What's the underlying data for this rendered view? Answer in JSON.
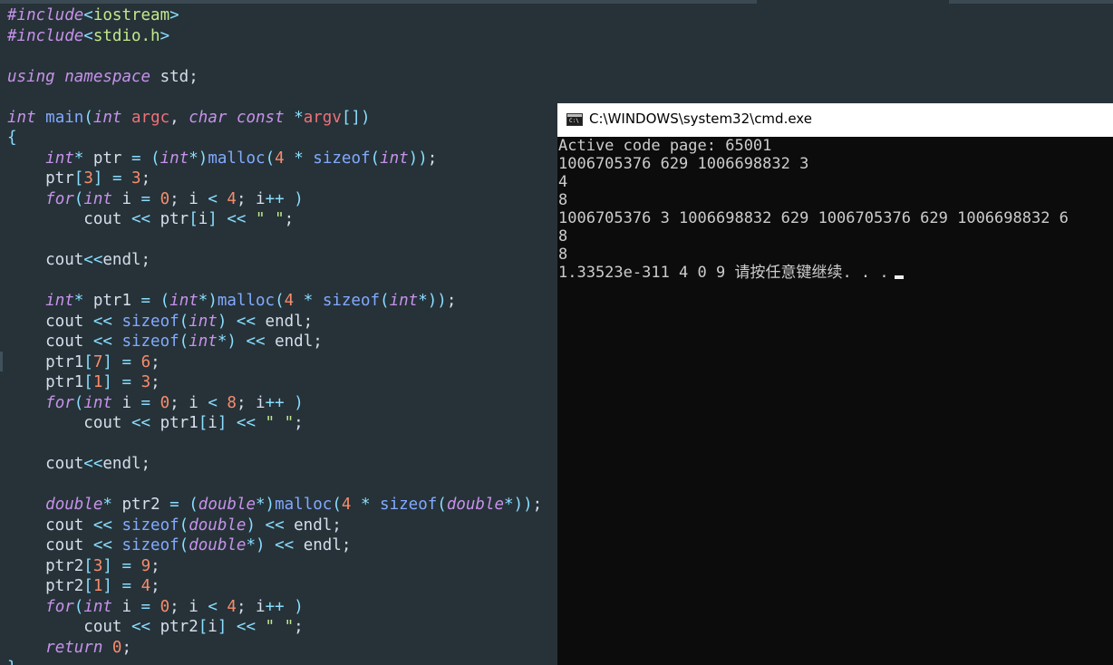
{
  "editor": {
    "lines": [
      {
        "t": [
          [
            "pp",
            "#include"
          ],
          [
            "op",
            "<"
          ],
          [
            "str",
            "iostream"
          ],
          [
            "op",
            ">"
          ]
        ]
      },
      {
        "t": [
          [
            "pp",
            "#include"
          ],
          [
            "op",
            "<"
          ],
          [
            "str",
            "stdio.h"
          ],
          [
            "op",
            ">"
          ]
        ]
      },
      {
        "t": []
      },
      {
        "t": [
          [
            "kw",
            "using"
          ],
          [
            "plain",
            " "
          ],
          [
            "kw",
            "namespace"
          ],
          [
            "plain",
            " std;"
          ]
        ]
      },
      {
        "t": []
      },
      {
        "t": [
          [
            "ty",
            "int"
          ],
          [
            "plain",
            " "
          ],
          [
            "fn",
            "main"
          ],
          [
            "br",
            "("
          ],
          [
            "ty",
            "int"
          ],
          [
            "plain",
            " "
          ],
          [
            "par",
            "argc"
          ],
          [
            "plain",
            ", "
          ],
          [
            "ty",
            "char"
          ],
          [
            "plain",
            " "
          ],
          [
            "kw",
            "const"
          ],
          [
            "plain",
            " "
          ],
          [
            "op",
            "*"
          ],
          [
            "par",
            "argv"
          ],
          [
            "br",
            "[])"
          ]
        ]
      },
      {
        "t": [
          [
            "br",
            "{"
          ]
        ]
      },
      {
        "t": [
          [
            "plain",
            "    "
          ],
          [
            "ty",
            "int"
          ],
          [
            "op",
            "*"
          ],
          [
            "plain",
            " ptr "
          ],
          [
            "op",
            "="
          ],
          [
            "plain",
            " "
          ],
          [
            "br",
            "("
          ],
          [
            "ty",
            "int"
          ],
          [
            "op",
            "*"
          ],
          [
            "br",
            ")"
          ],
          [
            "fn",
            "malloc"
          ],
          [
            "br",
            "("
          ],
          [
            "num",
            "4"
          ],
          [
            "plain",
            " "
          ],
          [
            "op",
            "*"
          ],
          [
            "plain",
            " "
          ],
          [
            "fn",
            "sizeof"
          ],
          [
            "br",
            "("
          ],
          [
            "ty",
            "int"
          ],
          [
            "br",
            "))"
          ],
          [
            "plain",
            ";"
          ]
        ]
      },
      {
        "t": [
          [
            "plain",
            "    ptr"
          ],
          [
            "br",
            "["
          ],
          [
            "num",
            "3"
          ],
          [
            "br",
            "]"
          ],
          [
            "plain",
            " "
          ],
          [
            "op",
            "="
          ],
          [
            "plain",
            " "
          ],
          [
            "num",
            "3"
          ],
          [
            "plain",
            ";"
          ]
        ]
      },
      {
        "t": [
          [
            "plain",
            "    "
          ],
          [
            "kw",
            "for"
          ],
          [
            "br",
            "("
          ],
          [
            "ty",
            "int"
          ],
          [
            "plain",
            " i "
          ],
          [
            "op",
            "="
          ],
          [
            "plain",
            " "
          ],
          [
            "num",
            "0"
          ],
          [
            "plain",
            "; i "
          ],
          [
            "op",
            "<"
          ],
          [
            "plain",
            " "
          ],
          [
            "num",
            "4"
          ],
          [
            "plain",
            "; i"
          ],
          [
            "op",
            "++"
          ],
          [
            "plain",
            " "
          ],
          [
            "br",
            ")"
          ]
        ]
      },
      {
        "t": [
          [
            "plain",
            "        cout "
          ],
          [
            "op",
            "<<"
          ],
          [
            "plain",
            " ptr"
          ],
          [
            "br",
            "["
          ],
          [
            "plain",
            "i"
          ],
          [
            "br",
            "]"
          ],
          [
            "plain",
            " "
          ],
          [
            "op",
            "<<"
          ],
          [
            "plain",
            " "
          ],
          [
            "str",
            "\" \""
          ],
          [
            "plain",
            ";"
          ]
        ]
      },
      {
        "t": []
      },
      {
        "t": [
          [
            "plain",
            "    cout"
          ],
          [
            "op",
            "<<"
          ],
          [
            "plain",
            "endl;"
          ]
        ]
      },
      {
        "t": []
      },
      {
        "t": [
          [
            "plain",
            "    "
          ],
          [
            "ty",
            "int"
          ],
          [
            "op",
            "*"
          ],
          [
            "plain",
            " ptr1 "
          ],
          [
            "op",
            "="
          ],
          [
            "plain",
            " "
          ],
          [
            "br",
            "("
          ],
          [
            "ty",
            "int"
          ],
          [
            "op",
            "*"
          ],
          [
            "br",
            ")"
          ],
          [
            "fn",
            "malloc"
          ],
          [
            "br",
            "("
          ],
          [
            "num",
            "4"
          ],
          [
            "plain",
            " "
          ],
          [
            "op",
            "*"
          ],
          [
            "plain",
            " "
          ],
          [
            "fn",
            "sizeof"
          ],
          [
            "br",
            "("
          ],
          [
            "ty",
            "int"
          ],
          [
            "op",
            "*"
          ],
          [
            "br",
            "))"
          ],
          [
            "plain",
            ";"
          ]
        ]
      },
      {
        "t": [
          [
            "plain",
            "    cout "
          ],
          [
            "op",
            "<<"
          ],
          [
            "plain",
            " "
          ],
          [
            "fn",
            "sizeof"
          ],
          [
            "br",
            "("
          ],
          [
            "ty",
            "int"
          ],
          [
            "br",
            ")"
          ],
          [
            "plain",
            " "
          ],
          [
            "op",
            "<<"
          ],
          [
            "plain",
            " endl;"
          ]
        ]
      },
      {
        "t": [
          [
            "plain",
            "    cout "
          ],
          [
            "op",
            "<<"
          ],
          [
            "plain",
            " "
          ],
          [
            "fn",
            "sizeof"
          ],
          [
            "br",
            "("
          ],
          [
            "ty",
            "int"
          ],
          [
            "op",
            "*"
          ],
          [
            "br",
            ")"
          ],
          [
            "plain",
            " "
          ],
          [
            "op",
            "<<"
          ],
          [
            "plain",
            " endl;"
          ]
        ]
      },
      {
        "t": [
          [
            "plain",
            "    ptr1"
          ],
          [
            "br",
            "["
          ],
          [
            "num",
            "7"
          ],
          [
            "br",
            "]"
          ],
          [
            "plain",
            " "
          ],
          [
            "op",
            "="
          ],
          [
            "plain",
            " "
          ],
          [
            "num",
            "6"
          ],
          [
            "plain",
            ";"
          ]
        ]
      },
      {
        "t": [
          [
            "plain",
            "    ptr1"
          ],
          [
            "br",
            "["
          ],
          [
            "num",
            "1"
          ],
          [
            "br",
            "]"
          ],
          [
            "plain",
            " "
          ],
          [
            "op",
            "="
          ],
          [
            "plain",
            " "
          ],
          [
            "num",
            "3"
          ],
          [
            "plain",
            ";"
          ]
        ]
      },
      {
        "t": [
          [
            "plain",
            "    "
          ],
          [
            "kw",
            "for"
          ],
          [
            "br",
            "("
          ],
          [
            "ty",
            "int"
          ],
          [
            "plain",
            " i "
          ],
          [
            "op",
            "="
          ],
          [
            "plain",
            " "
          ],
          [
            "num",
            "0"
          ],
          [
            "plain",
            "; i "
          ],
          [
            "op",
            "<"
          ],
          [
            "plain",
            " "
          ],
          [
            "num",
            "8"
          ],
          [
            "plain",
            "; i"
          ],
          [
            "op",
            "++"
          ],
          [
            "plain",
            " "
          ],
          [
            "br",
            ")"
          ]
        ]
      },
      {
        "t": [
          [
            "plain",
            "        cout "
          ],
          [
            "op",
            "<<"
          ],
          [
            "plain",
            " ptr1"
          ],
          [
            "br",
            "["
          ],
          [
            "plain",
            "i"
          ],
          [
            "br",
            "]"
          ],
          [
            "plain",
            " "
          ],
          [
            "op",
            "<<"
          ],
          [
            "plain",
            " "
          ],
          [
            "str",
            "\" \""
          ],
          [
            "plain",
            ";"
          ]
        ]
      },
      {
        "t": []
      },
      {
        "t": [
          [
            "plain",
            "    cout"
          ],
          [
            "op",
            "<<"
          ],
          [
            "plain",
            "endl;"
          ]
        ]
      },
      {
        "t": []
      },
      {
        "t": [
          [
            "plain",
            "    "
          ],
          [
            "ty",
            "double"
          ],
          [
            "op",
            "*"
          ],
          [
            "plain",
            " ptr2 "
          ],
          [
            "op",
            "="
          ],
          [
            "plain",
            " "
          ],
          [
            "br",
            "("
          ],
          [
            "ty",
            "double"
          ],
          [
            "op",
            "*"
          ],
          [
            "br",
            ")"
          ],
          [
            "fn",
            "malloc"
          ],
          [
            "br",
            "("
          ],
          [
            "num",
            "4"
          ],
          [
            "plain",
            " "
          ],
          [
            "op",
            "*"
          ],
          [
            "plain",
            " "
          ],
          [
            "fn",
            "sizeof"
          ],
          [
            "br",
            "("
          ],
          [
            "ty",
            "double"
          ],
          [
            "op",
            "*"
          ],
          [
            "br",
            "))"
          ],
          [
            "plain",
            ";"
          ]
        ]
      },
      {
        "t": [
          [
            "plain",
            "    cout "
          ],
          [
            "op",
            "<<"
          ],
          [
            "plain",
            " "
          ],
          [
            "fn",
            "sizeof"
          ],
          [
            "br",
            "("
          ],
          [
            "ty",
            "double"
          ],
          [
            "br",
            ")"
          ],
          [
            "plain",
            " "
          ],
          [
            "op",
            "<<"
          ],
          [
            "plain",
            " endl;"
          ]
        ]
      },
      {
        "t": [
          [
            "plain",
            "    cout "
          ],
          [
            "op",
            "<<"
          ],
          [
            "plain",
            " "
          ],
          [
            "fn",
            "sizeof"
          ],
          [
            "br",
            "("
          ],
          [
            "ty",
            "double"
          ],
          [
            "op",
            "*"
          ],
          [
            "br",
            ")"
          ],
          [
            "plain",
            " "
          ],
          [
            "op",
            "<<"
          ],
          [
            "plain",
            " endl;"
          ]
        ]
      },
      {
        "t": [
          [
            "plain",
            "    ptr2"
          ],
          [
            "br",
            "["
          ],
          [
            "num",
            "3"
          ],
          [
            "br",
            "]"
          ],
          [
            "plain",
            " "
          ],
          [
            "op",
            "="
          ],
          [
            "plain",
            " "
          ],
          [
            "num",
            "9"
          ],
          [
            "plain",
            ";"
          ]
        ]
      },
      {
        "t": [
          [
            "plain",
            "    ptr2"
          ],
          [
            "br",
            "["
          ],
          [
            "num",
            "1"
          ],
          [
            "br",
            "]"
          ],
          [
            "plain",
            " "
          ],
          [
            "op",
            "="
          ],
          [
            "plain",
            " "
          ],
          [
            "num",
            "4"
          ],
          [
            "plain",
            ";"
          ]
        ]
      },
      {
        "t": [
          [
            "plain",
            "    "
          ],
          [
            "kw",
            "for"
          ],
          [
            "br",
            "("
          ],
          [
            "ty",
            "int"
          ],
          [
            "plain",
            " i "
          ],
          [
            "op",
            "="
          ],
          [
            "plain",
            " "
          ],
          [
            "num",
            "0"
          ],
          [
            "plain",
            "; i "
          ],
          [
            "op",
            "<"
          ],
          [
            "plain",
            " "
          ],
          [
            "num",
            "4"
          ],
          [
            "plain",
            "; i"
          ],
          [
            "op",
            "++"
          ],
          [
            "plain",
            " "
          ],
          [
            "br",
            ")"
          ]
        ]
      },
      {
        "t": [
          [
            "plain",
            "        cout "
          ],
          [
            "op",
            "<<"
          ],
          [
            "plain",
            " ptr2"
          ],
          [
            "br",
            "["
          ],
          [
            "plain",
            "i"
          ],
          [
            "br",
            "]"
          ],
          [
            "plain",
            " "
          ],
          [
            "op",
            "<<"
          ],
          [
            "plain",
            " "
          ],
          [
            "str",
            "\" \""
          ],
          [
            "plain",
            ";"
          ]
        ]
      },
      {
        "t": [
          [
            "plain",
            "    "
          ],
          [
            "kw",
            "return"
          ],
          [
            "plain",
            " "
          ],
          [
            "num",
            "0"
          ],
          [
            "plain",
            ";"
          ]
        ]
      },
      {
        "t": [
          [
            "br",
            "}"
          ]
        ]
      }
    ]
  },
  "console_window": {
    "title": "C:\\WINDOWS\\system32\\cmd.exe",
    "icon_text": "C:\\",
    "lines": [
      "Active code page: 65001",
      "1006705376 629 1006698832 3",
      "4",
      "8",
      "1006705376 3 1006698832 629 1006705376 629 1006698832 6",
      "8",
      "8",
      "1.33523e-311 4 0 9 请按任意键继续. . ."
    ]
  }
}
